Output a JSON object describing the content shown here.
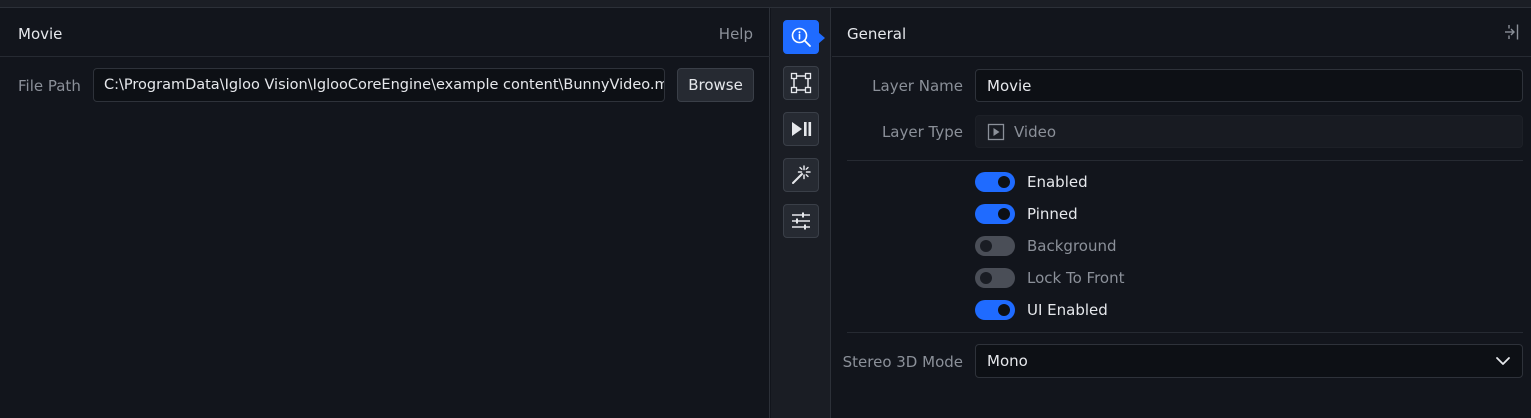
{
  "left": {
    "title": "Movie",
    "help_label": "Help",
    "file_path_label": "File Path",
    "file_path_value": "C:\\ProgramData\\Igloo Vision\\IglooCoreEngine\\example content\\BunnyVideo.m",
    "browse_label": "Browse"
  },
  "rail": {
    "items": [
      {
        "icon": "info-search-icon",
        "active": true
      },
      {
        "icon": "transform-icon",
        "active": false
      },
      {
        "icon": "play-pause-icon",
        "active": false
      },
      {
        "icon": "magic-wand-icon",
        "active": false
      },
      {
        "icon": "sliders-icon",
        "active": false
      }
    ],
    "accent_color": "#1f6bff"
  },
  "right": {
    "title": "General",
    "layer_name_label": "Layer Name",
    "layer_name_value": "Movie",
    "layer_type_label": "Layer Type",
    "layer_type_value": "Video",
    "toggles": [
      {
        "label": "Enabled",
        "on": true
      },
      {
        "label": "Pinned",
        "on": true
      },
      {
        "label": "Background",
        "on": false
      },
      {
        "label": "Lock To Front",
        "on": false
      },
      {
        "label": "UI Enabled",
        "on": true
      }
    ],
    "stereo_label": "Stereo 3D Mode",
    "stereo_value": "Mono"
  }
}
